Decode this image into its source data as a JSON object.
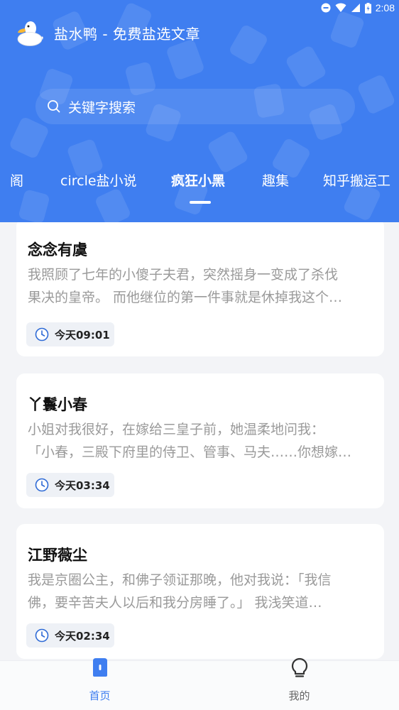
{
  "status_bar": {
    "time": "2:08"
  },
  "app": {
    "title": "盐水鸭 - 免费盐选文章"
  },
  "search": {
    "placeholder": "关键字搜索"
  },
  "tabs": [
    {
      "label": "阁",
      "active": false
    },
    {
      "label": "circle盐小说",
      "active": false
    },
    {
      "label": "疯狂小黑",
      "active": true
    },
    {
      "label": "趣集",
      "active": false
    },
    {
      "label": "知乎搬运工",
      "active": false
    }
  ],
  "articles": [
    {
      "title": "念念有虞",
      "excerpt_line1": "我照顾了七年的小傻子夫君，突然摇身一变成了杀伐",
      "excerpt_line2": "果决的皇帝。 而他继位的第一件事就是休掉我这个…",
      "time": "今天09:01"
    },
    {
      "title": "丫鬟小春",
      "excerpt_line1": "小姐对我很好，在嫁给三皇子前，她温柔地问我：",
      "excerpt_line2": "「小春，三殿下府里的侍卫、管事、马夫……你想嫁…",
      "time": "今天03:34"
    },
    {
      "title": "江野薇尘",
      "excerpt_line1": "我是京圈公主，和佛子领证那晚，他对我说：「我信",
      "excerpt_line2": "佛，要辛苦夫人以后和我分房睡了。」 我浅笑道…",
      "time": "今天02:34"
    }
  ],
  "bottom_nav": {
    "home_label": "首页",
    "mine_label": "我的"
  },
  "colors": {
    "brand": "#3f7ef0",
    "active_nav": "#3f7ef0",
    "inactive_nav": "#666666"
  }
}
